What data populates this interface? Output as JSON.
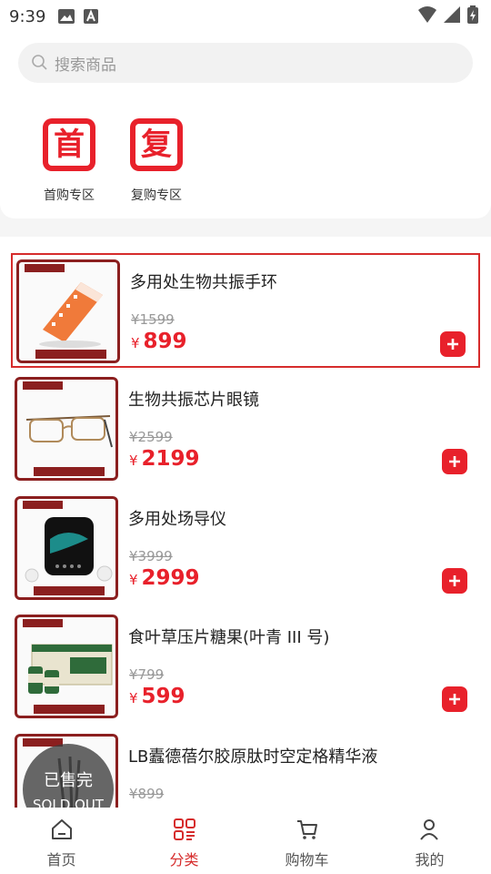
{
  "status_bar": {
    "time": "9:39"
  },
  "search": {
    "placeholder": "搜索商品"
  },
  "entries": [
    {
      "char": "首",
      "label": "首购专区"
    },
    {
      "char": "复",
      "label": "复购专区"
    }
  ],
  "products": [
    {
      "name": "多用处生物共振手环",
      "old_price": "¥1599",
      "currency": "¥",
      "price": "899",
      "sold_out": false
    },
    {
      "name": "生物共振芯片眼镜",
      "old_price": "¥2599",
      "currency": "¥",
      "price": "2199",
      "sold_out": false
    },
    {
      "name": "多用处场导仪",
      "old_price": "¥3999",
      "currency": "¥",
      "price": "2999",
      "sold_out": false
    },
    {
      "name": "食叶草压片糖果(叶青 III 号)",
      "old_price": "¥799",
      "currency": "¥",
      "price": "599",
      "sold_out": false
    },
    {
      "name": "LB蠹德蓓尔胶原肽时空定格精华液",
      "old_price": "¥899",
      "currency": "¥",
      "price": "",
      "sold_out": true,
      "sold_out_cn": "已售完",
      "sold_out_en": "SOLD OUT"
    }
  ],
  "nav": [
    {
      "label": "首页",
      "icon": "home-icon"
    },
    {
      "label": "分类",
      "icon": "category-icon",
      "active": true
    },
    {
      "label": "购物车",
      "icon": "cart-icon"
    },
    {
      "label": "我的",
      "icon": "user-icon"
    }
  ],
  "colors": {
    "accent": "#e8212b",
    "thumb_frame": "#8b1f1f",
    "selected_border": "#d62c2c"
  }
}
